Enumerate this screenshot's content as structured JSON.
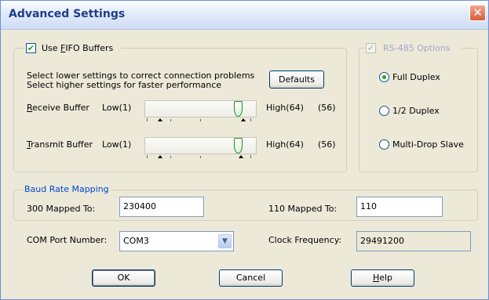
{
  "window": {
    "title": "Advanced Settings",
    "close_glyph": "✕"
  },
  "fifo": {
    "checkbox_label_pre": "Use ",
    "checkbox_label_mnemonic": "F",
    "checkbox_label_post": "IFO Buffers",
    "checked": true,
    "hint_line1": "Select lower settings to correct connection problems",
    "hint_line2": "Select higher settings for faster performance",
    "defaults_label": "Defaults",
    "receive": {
      "label_mnemonic": "R",
      "label_rest": "eceive Buffer",
      "low": "Low(1)",
      "high": "High(64)",
      "value_text": "(56)",
      "level": 0.87
    },
    "transmit": {
      "label_mnemonic": "T",
      "label_rest": "ransmit Buffer",
      "low": "Low(1)",
      "high": "High(64)",
      "value_text": "(56)",
      "level": 0.87
    }
  },
  "rs485": {
    "title": "RS-485 Options",
    "enabled": false,
    "options": [
      {
        "label": "Full Duplex",
        "selected": true
      },
      {
        "label": "1/2 Duplex",
        "selected": false
      },
      {
        "label": "Multi-Drop Slave",
        "selected": false
      }
    ]
  },
  "baud": {
    "title": "Baud Rate Mapping",
    "map300_label": "300 Mapped To:",
    "map300_value": "230400",
    "map110_label": "110 Mapped To:",
    "map110_value": "110"
  },
  "com_port": {
    "label": "COM Port Number:",
    "value": "COM3",
    "dropdown_icon": "chevron-down-icon"
  },
  "clock": {
    "label": "Clock Frequency:",
    "value": "29491200"
  },
  "buttons": {
    "ok": "OK",
    "cancel": "Cancel",
    "help_mnemonic": "H",
    "help_rest": "elp"
  },
  "colors": {
    "group_title": "#0046d5",
    "title_text": "#1f3e86",
    "check_mark": "#21a121",
    "close_button": "#d85b3a"
  }
}
